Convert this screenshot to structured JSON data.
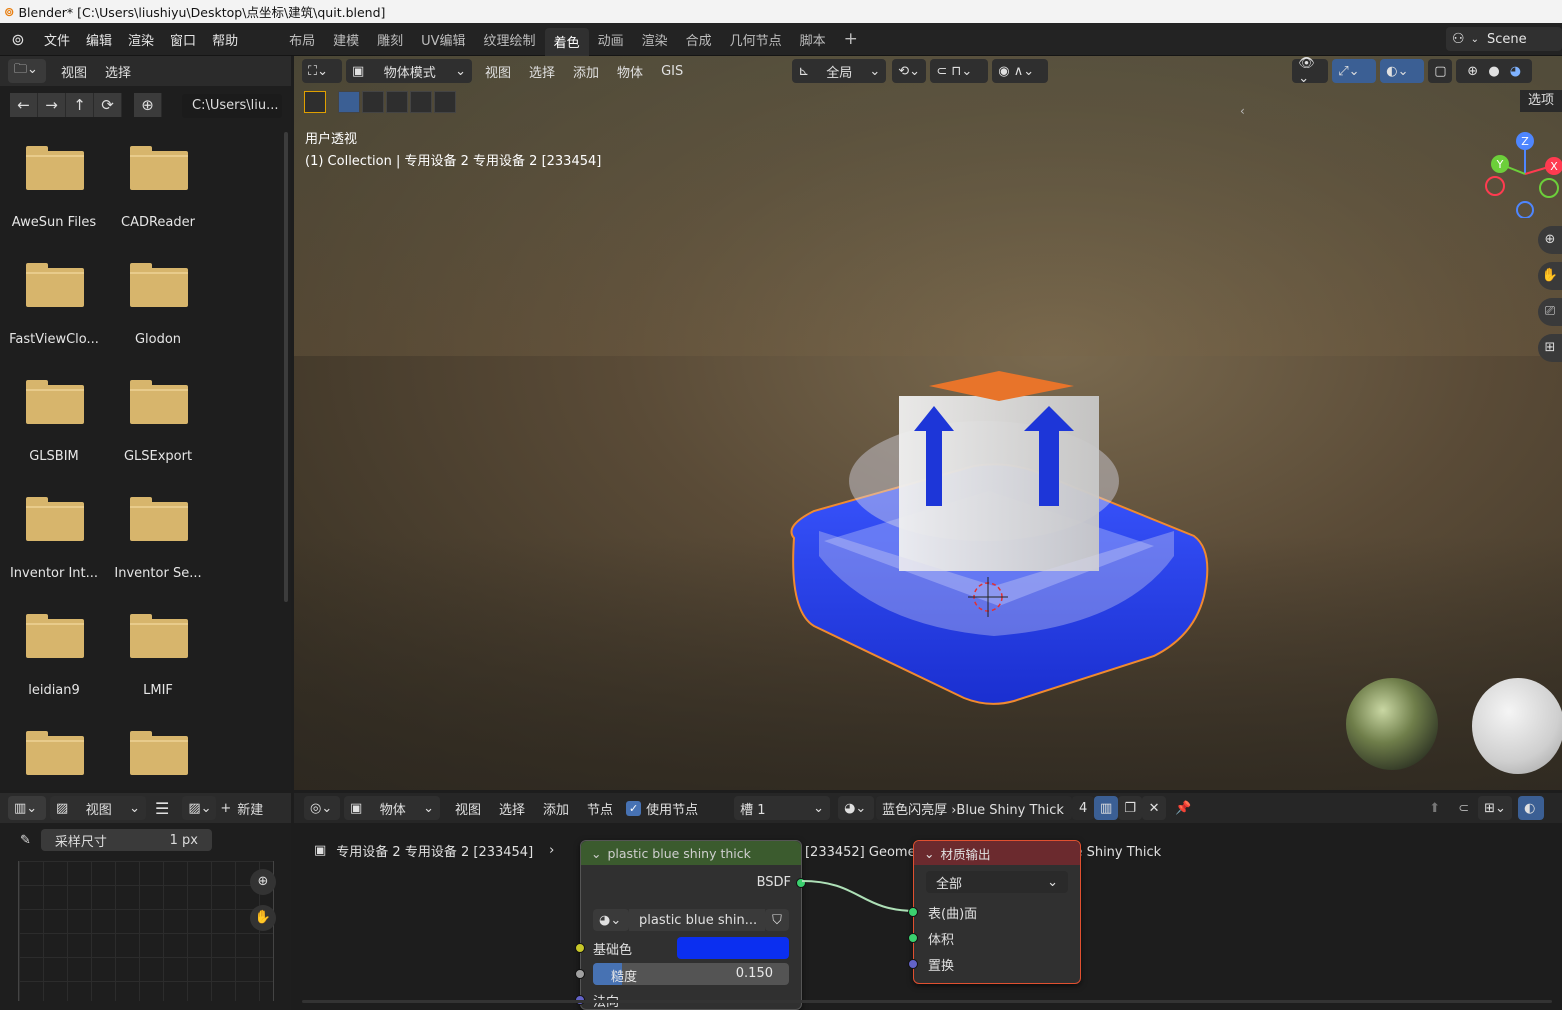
{
  "window": {
    "title": "Blender* [C:\\Users\\liushiyu\\Desktop\\点坐标\\建筑\\quit.blend]"
  },
  "menu": [
    "文件",
    "编辑",
    "渲染",
    "窗口",
    "帮助"
  ],
  "workspaces": [
    "布局",
    "建模",
    "雕刻",
    "UV编辑",
    "纹理绘制",
    "着色",
    "动画",
    "渲染",
    "合成",
    "几何节点",
    "脚本"
  ],
  "active_workspace": "着色",
  "scene": "Scene",
  "file_browser": {
    "menus": [
      "视图",
      "选择"
    ],
    "path": "C:\\Users\\liu...",
    "folders": [
      "AweSun Files",
      "CADReader",
      "FastViewClo...",
      "Glodon",
      "GLSBIM",
      "GLSExport",
      "Inventor Int...",
      "Inventor Se...",
      "leidian9",
      "LMIF",
      "",
      ""
    ]
  },
  "viewport": {
    "mode": "物体模式",
    "menus": [
      "视图",
      "选择",
      "添加",
      "物体",
      "GIS"
    ],
    "transform": "全局",
    "options": "选项",
    "view_name": "用户透视",
    "object_info": "(1) Collection | 专用设备 2 专用设备 2 [233454]",
    "axes": {
      "x": "X",
      "y": "Y",
      "z": "Z"
    }
  },
  "image_editor": {
    "view_menu": "视图",
    "new_label": "新建",
    "sample_label": "采样尺寸",
    "sample_value": "1 px"
  },
  "node_editor": {
    "type": "物体",
    "menus": [
      "视图",
      "选择",
      "添加",
      "节点"
    ],
    "use_nodes": "使用节点",
    "slot": "槽 1",
    "material": "蓝色闪亮厚 ›Blue Shiny Thick",
    "users": "4",
    "breadcrumb": "专用设备 2 专用设备 2 [233454]",
    "breadcrumb_b": "专用设备 2 专用设备 2 [233454] [233452] Geometry",
    "breadcrumb_c": "蓝色闪亮厚 ›Blue Shiny Thick",
    "bsdf_node": {
      "title": "plastic blue shiny thick",
      "output": "BSDF",
      "material": "plastic blue shin...",
      "base_color_label": "基础色",
      "base_color": "#0b2ff0",
      "roughness_label": "糙度",
      "roughness": "0.150",
      "normal_label": "法向"
    },
    "output_node": {
      "title": "材质输出",
      "target": "全部",
      "inputs": [
        "表(曲)面",
        "体积",
        "置换"
      ]
    }
  }
}
